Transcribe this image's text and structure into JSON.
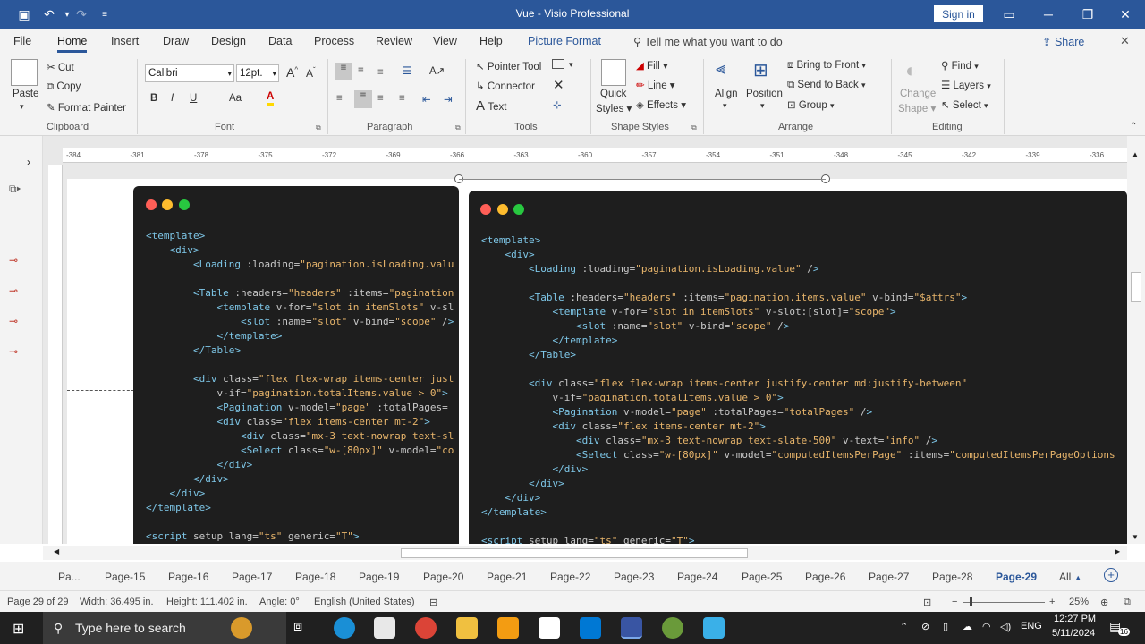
{
  "window": {
    "title": "Vue  -  Visio Professional",
    "signin": "Sign in"
  },
  "quickaccess": {
    "save": "save-icon",
    "undo": "undo-icon",
    "redo": "redo-icon",
    "customize": "customize-icon"
  },
  "tabs": [
    "File",
    "Home",
    "Insert",
    "Draw",
    "Design",
    "Data",
    "Process",
    "Review",
    "View",
    "Help",
    "Picture Format"
  ],
  "tell": "Tell me what you want to do",
  "share": "Share",
  "ribbon": {
    "clipboard": {
      "paste": "Paste",
      "cut": "Cut",
      "copy": "Copy",
      "format_painter": "Format Painter",
      "label": "Clipboard"
    },
    "font": {
      "name": "Calibri",
      "size": "12pt.",
      "label": "Font",
      "bold": "B",
      "italic": "I",
      "underline": "U",
      "case": "Aa",
      "color": "A"
    },
    "paragraph": {
      "label": "Paragraph"
    },
    "tools": {
      "pointer": "Pointer Tool",
      "connector": "Connector",
      "text": "Text",
      "label": "Tools"
    },
    "shape_styles": {
      "quick": "Quick",
      "styles": "Styles",
      "fill": "Fill",
      "line": "Line",
      "effects": "Effects",
      "label": "Shape Styles"
    },
    "arrange": {
      "align": "Align",
      "position": "Position",
      "front": "Bring to Front",
      "back": "Send to Back",
      "group": "Group",
      "label": "Arrange"
    },
    "editing": {
      "change": "Change",
      "shape": "Shape",
      "find": "Find",
      "layers": "Layers",
      "select": "Select",
      "label": "Editing"
    }
  },
  "ruler": [
    "-384",
    "-381",
    "-378",
    "-375",
    "-372",
    "-369",
    "-366",
    "-363",
    "-360",
    "-357",
    "-354",
    "-351",
    "-348",
    "-345",
    "-342",
    "-339",
    "-336"
  ],
  "code_left": [
    "<template>",
    "    <div>",
    "        <Loading :loading=\"pagination.isLoading.valu",
    "",
    "        <Table :headers=\"headers\" :items=\"pagination",
    "            <template v-for=\"slot in itemSlots\" v-sl",
    "                <slot :name=\"slot\" v-bind=\"scope\" />",
    "            </template>",
    "        </Table>",
    "",
    "        <div class=\"flex flex-wrap items-center just",
    "            v-if=\"pagination.totalItems.value > 0\">",
    "            <Pagination v-model=\"page\" :totalPages=",
    "            <div class=\"flex items-center mt-2\">",
    "                <div class=\"mx-3 text-nowrap text-sl",
    "                <Select class=\"w-[80px]\" v-model=\"co",
    "            </div>",
    "        </div>",
    "    </div>",
    "</template>",
    "",
    "<script setup lang=\"ts\" generic=\"T\">"
  ],
  "code_right": [
    "<template>",
    "    <div>",
    "        <Loading :loading=\"pagination.isLoading.value\" />",
    "",
    "        <Table :headers=\"headers\" :items=\"pagination.items.value\" v-bind=\"$attrs\">",
    "            <template v-for=\"slot in itemSlots\" v-slot:[slot]=\"scope\">",
    "                <slot :name=\"slot\" v-bind=\"scope\" />",
    "            </template>",
    "        </Table>",
    "",
    "        <div class=\"flex flex-wrap items-center justify-center md:justify-between\"",
    "            v-if=\"pagination.totalItems.value > 0\">",
    "            <Pagination v-model=\"page\" :totalPages=\"totalPages\" />",
    "            <div class=\"flex items-center mt-2\">",
    "                <div class=\"mx-3 text-nowrap text-slate-500\" v-text=\"info\" />",
    "                <Select class=\"w-[80px]\" v-model=\"computedItemsPerPage\" :items=\"computedItemsPerPageOptions",
    "            </div>",
    "        </div>",
    "    </div>",
    "</template>",
    "",
    "<script setup lang=\"ts\" generic=\"T\">"
  ],
  "page_tabs": [
    "Pa...",
    "Page-15",
    "Page-16",
    "Page-17",
    "Page-18",
    "Page-19",
    "Page-20",
    "Page-21",
    "Page-22",
    "Page-23",
    "Page-24",
    "Page-25",
    "Page-26",
    "Page-27",
    "Page-28",
    "Page-29",
    "All"
  ],
  "active_page": "Page-29",
  "status": {
    "page": "Page 29 of 29",
    "width": "Width: 36.495 in.",
    "height": "Height: 111.402 in.",
    "angle": "Angle: 0°",
    "lang": "English (United States)",
    "zoom": "25%"
  },
  "taskbar": {
    "search": "Type here to search",
    "time": "12:27 PM",
    "date": "5/11/2024",
    "lang": "ENG",
    "notif": "16"
  },
  "colors": {
    "accent": "#2b579a",
    "code_bg": "#1e1e1e",
    "tag": "#7ec7e8",
    "attr": "#c8d980",
    "string": "#e8b56b"
  }
}
